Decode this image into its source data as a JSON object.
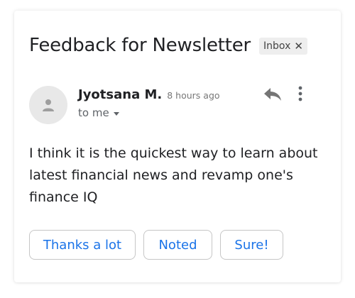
{
  "email": {
    "subject": "Feedback for Newsletter",
    "label": "Inbox",
    "label_close_icon": "close-icon",
    "sender_name": "Jyotsana M.",
    "time": "8 hours ago",
    "recipient": "to me",
    "body": "I think it is the quickest way to learn about latest financial news and revamp one's finance IQ"
  },
  "actions": {
    "reply_icon": "reply-icon",
    "more_icon": "more-vertical-icon"
  },
  "smart_replies": [
    {
      "label": "Thanks a lot"
    },
    {
      "label": "Noted"
    },
    {
      "label": "Sure!"
    }
  ],
  "colors": {
    "accent": "#1a73e8",
    "text": "#202124",
    "muted": "#5f6368",
    "chip_bg": "#eeeeee",
    "avatar_bg": "#e8e8e8"
  }
}
